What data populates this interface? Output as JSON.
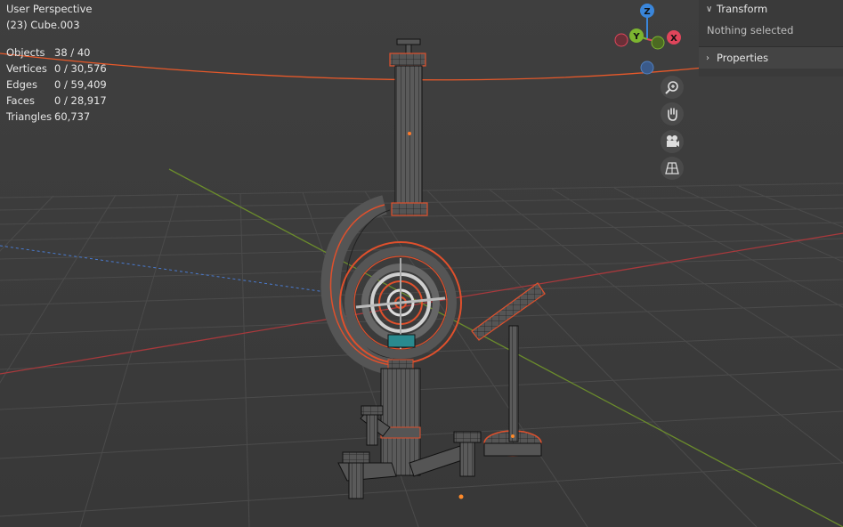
{
  "viewport": {
    "view_name": "User Perspective",
    "active_object": "(23) Cube.003"
  },
  "stats": [
    {
      "label": "Objects",
      "value": "38 / 40"
    },
    {
      "label": "Vertices",
      "value": "0 / 30,576"
    },
    {
      "label": "Edges",
      "value": "0 / 59,409"
    },
    {
      "label": "Faces",
      "value": "0 / 28,917"
    },
    {
      "label": "Triangles",
      "value": "60,737"
    }
  ],
  "gizmo": {
    "z_label": "Z",
    "y_label": "Y",
    "x_label": "X",
    "colors": {
      "x": "#e0455b",
      "y": "#7cb530",
      "z": "#3a86db"
    }
  },
  "nav_buttons": [
    {
      "name": "zoom-icon"
    },
    {
      "name": "pan-hand-icon"
    },
    {
      "name": "camera-icon"
    },
    {
      "name": "perspective-grid-icon"
    }
  ],
  "sidebar": {
    "transform_label": "Transform",
    "transform_body": "Nothing selected",
    "properties_label": "Properties"
  },
  "colors": {
    "selection_outline": "#ff5a2a",
    "wire": "#1a1a1a",
    "grid_line": "#4a4a4a",
    "x_axis": "#b03a3a",
    "y_axis": "#6a8a2a"
  }
}
